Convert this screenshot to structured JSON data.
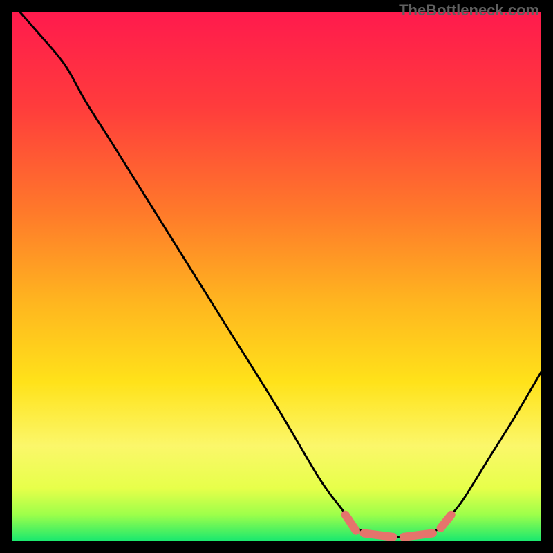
{
  "watermark": "TheBottleneck.com",
  "chart_data": {
    "type": "line",
    "title": "",
    "xlabel": "",
    "ylabel": "",
    "xlim": [
      0,
      100
    ],
    "ylim": [
      0,
      100
    ],
    "gradient_stops": [
      {
        "offset": 0,
        "color": "#ff1a4d"
      },
      {
        "offset": 18,
        "color": "#ff3c3c"
      },
      {
        "offset": 38,
        "color": "#ff7a2a"
      },
      {
        "offset": 55,
        "color": "#ffb61f"
      },
      {
        "offset": 70,
        "color": "#ffe21a"
      },
      {
        "offset": 82,
        "color": "#fbf76a"
      },
      {
        "offset": 90,
        "color": "#e7ff4a"
      },
      {
        "offset": 95,
        "color": "#9dff4a"
      },
      {
        "offset": 100,
        "color": "#18e86f"
      }
    ],
    "series": [
      {
        "name": "bottleneck-curve",
        "color": "#000000",
        "points": [
          {
            "x": 1.5,
            "y": 100.0
          },
          {
            "x": 5.0,
            "y": 96.0
          },
          {
            "x": 10.0,
            "y": 90.0
          },
          {
            "x": 14.0,
            "y": 83.0
          },
          {
            "x": 20.0,
            "y": 73.5
          },
          {
            "x": 30.0,
            "y": 57.5
          },
          {
            "x": 40.0,
            "y": 41.5
          },
          {
            "x": 50.0,
            "y": 25.5
          },
          {
            "x": 58.0,
            "y": 12.0
          },
          {
            "x": 62.0,
            "y": 6.5
          },
          {
            "x": 64.0,
            "y": 4.0
          },
          {
            "x": 66.0,
            "y": 2.0
          },
          {
            "x": 70.0,
            "y": 1.0
          },
          {
            "x": 76.0,
            "y": 1.0
          },
          {
            "x": 80.0,
            "y": 2.0
          },
          {
            "x": 82.0,
            "y": 4.0
          },
          {
            "x": 85.0,
            "y": 7.5
          },
          {
            "x": 90.0,
            "y": 15.5
          },
          {
            "x": 95.0,
            "y": 23.5
          },
          {
            "x": 100.0,
            "y": 32.0
          }
        ]
      },
      {
        "name": "optimal-markers",
        "color": "#e5746c",
        "segments": [
          {
            "x1": 63.0,
            "y1": 5.0,
            "x2": 65.0,
            "y2": 2.0
          },
          {
            "x1": 66.5,
            "y1": 1.5,
            "x2": 72.0,
            "y2": 0.8
          },
          {
            "x1": 74.0,
            "y1": 0.8,
            "x2": 79.5,
            "y2": 1.5
          },
          {
            "x1": 81.0,
            "y1": 2.5,
            "x2": 83.0,
            "y2": 5.0
          }
        ]
      }
    ]
  }
}
